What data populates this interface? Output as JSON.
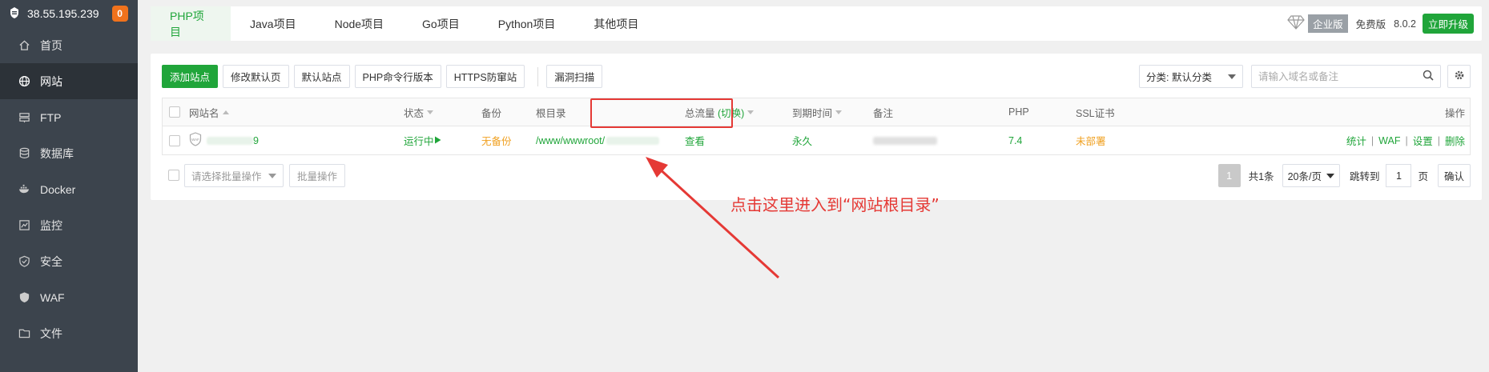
{
  "sidebar": {
    "host_ip": "38.55.195.239",
    "badge_count": "0",
    "items": [
      {
        "label": "首页",
        "icon": "home-icon"
      },
      {
        "label": "网站",
        "icon": "globe-icon",
        "active": true
      },
      {
        "label": "FTP",
        "icon": "ftp-icon"
      },
      {
        "label": "数据库",
        "icon": "database-icon"
      },
      {
        "label": "Docker",
        "icon": "docker-icon"
      },
      {
        "label": "监控",
        "icon": "monitor-icon"
      },
      {
        "label": "安全",
        "icon": "shield-icon"
      },
      {
        "label": "WAF",
        "icon": "waf-icon"
      },
      {
        "label": "文件",
        "icon": "folder-icon"
      }
    ]
  },
  "tabs": [
    "PHP项目",
    "Java项目",
    "Node项目",
    "Go项目",
    "Python项目",
    "其他项目"
  ],
  "header_right": {
    "edition": "企业版",
    "free": "免费版",
    "version": "8.0.2",
    "upgrade": "立即升级"
  },
  "toolbar": {
    "buttons": [
      "添加站点",
      "修改默认页",
      "默认站点",
      "PHP命令行版本",
      "HTTPS防窜站",
      "漏洞扫描"
    ],
    "category": "分类: 默认分类",
    "search_placeholder": "请输入域名或备注"
  },
  "table": {
    "headers": {
      "name": "网站名",
      "status": "状态",
      "backup": "备份",
      "root": "根目录",
      "traffic": "总流量",
      "traffic_switch": "(切换)",
      "expire": "到期时间",
      "remark": "备注",
      "php": "PHP",
      "ssl": "SSL证书",
      "ops": "操作"
    },
    "rows": [
      {
        "name_suffix": "9",
        "status": "运行中",
        "backup": "无备份",
        "root": "/www/wwwroot/",
        "traffic": "查看",
        "expire": "永久",
        "php": "7.4",
        "ssl": "未部署",
        "ops": [
          "统计",
          "WAF",
          "设置",
          "删除"
        ]
      }
    ]
  },
  "footer": {
    "batch_placeholder": "请选择批量操作",
    "batch_button": "批量操作",
    "current_page": "1",
    "total": "共1条",
    "page_size": "20条/页",
    "jump_label": "跳转到",
    "jump_value": "1",
    "page_unit": "页",
    "confirm": "确认"
  },
  "annotation": {
    "text": "点击这里进入到“网站根目录”",
    "color": "#e53935"
  },
  "colors": {
    "accent": "#20a53a",
    "sidebar_bg": "#3c444d",
    "warning": "#f0a020"
  }
}
